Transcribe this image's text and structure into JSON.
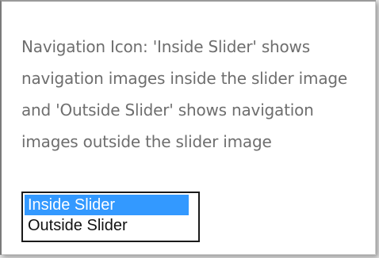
{
  "setting": {
    "description": "Navigation Icon: 'Inside Slider' shows navigation images inside the slider image and 'Outside Slider' shows navigation images outside the slider image",
    "options": [
      {
        "label": "Inside Slider",
        "selected": true
      },
      {
        "label": "Outside Slider",
        "selected": false
      }
    ],
    "selected_value": "Inside Slider"
  },
  "colors": {
    "selection_background": "#3399ff",
    "description_text": "#6e6e6e",
    "listbox_border": "#1a1a1a"
  }
}
